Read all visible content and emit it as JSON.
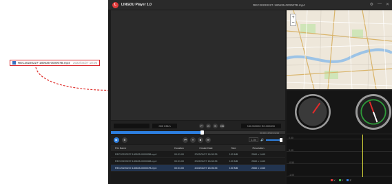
{
  "callout": {
    "filename": "REC20220227-180635-000007B.mp4",
    "timestamp": "2022/02/27 18:06"
  },
  "app": {
    "title": "LINGDU Player 1.0",
    "window_title": "REC20220227-180635-000007B.mp4",
    "logo": "L"
  },
  "window_controls": {
    "settings_icon": "⚙",
    "minimize": "—",
    "close": "✕"
  },
  "map": {
    "zoom_in": "+",
    "zoom_out": "−"
  },
  "infobar": {
    "speed": "000 KM/h",
    "icons": [
      "P",
      "G",
      "S",
      "HD"
    ],
    "coords": "N0.000000 E0.000000"
  },
  "player": {
    "time": "00:00:19/00:01:00",
    "seek_fraction": 0.52,
    "volume_fraction": 0.8,
    "speed": "1.0x"
  },
  "controls": {
    "play": "▶",
    "folder": "⌸",
    "prev": "⏮",
    "pause": "⏸",
    "stop": "■",
    "next": "⏭",
    "speaker": "🔊"
  },
  "graph": {
    "y_labels": [
      "0.50",
      "0.00",
      "-0.50",
      "-1.00"
    ],
    "legend": [
      "X",
      "Y",
      "Z"
    ],
    "legend_colors": [
      "#e23b3b",
      "#3fbf4f",
      "#3a7fe0"
    ]
  },
  "table": {
    "headers": [
      "File Name",
      "Duration",
      "Create Date",
      "Size",
      "Resolution"
    ],
    "rows": [
      {
        "name": "REC20220227-180535-000005B.mp4",
        "duration": "00:01:00",
        "date": "2022/02/27 18:05:35",
        "size": "100 MB",
        "res": "2560 x 1440"
      },
      {
        "name": "REC20220227-180635-000006B.mp4",
        "duration": "00:01:00",
        "date": "2022/02/27 18:06:35",
        "size": "100 MB",
        "res": "2560 x 1440"
      },
      {
        "name": "REC20220227-180635-000007B.mp4",
        "duration": "00:01:00",
        "date": "2022/02/27 18:06:35",
        "size": "100 MB",
        "res": "2560 x 1440"
      }
    ]
  },
  "colors": {
    "accent": "#2d7fe0",
    "callout_border": "#d8262b",
    "arrow": "#e0322f"
  }
}
